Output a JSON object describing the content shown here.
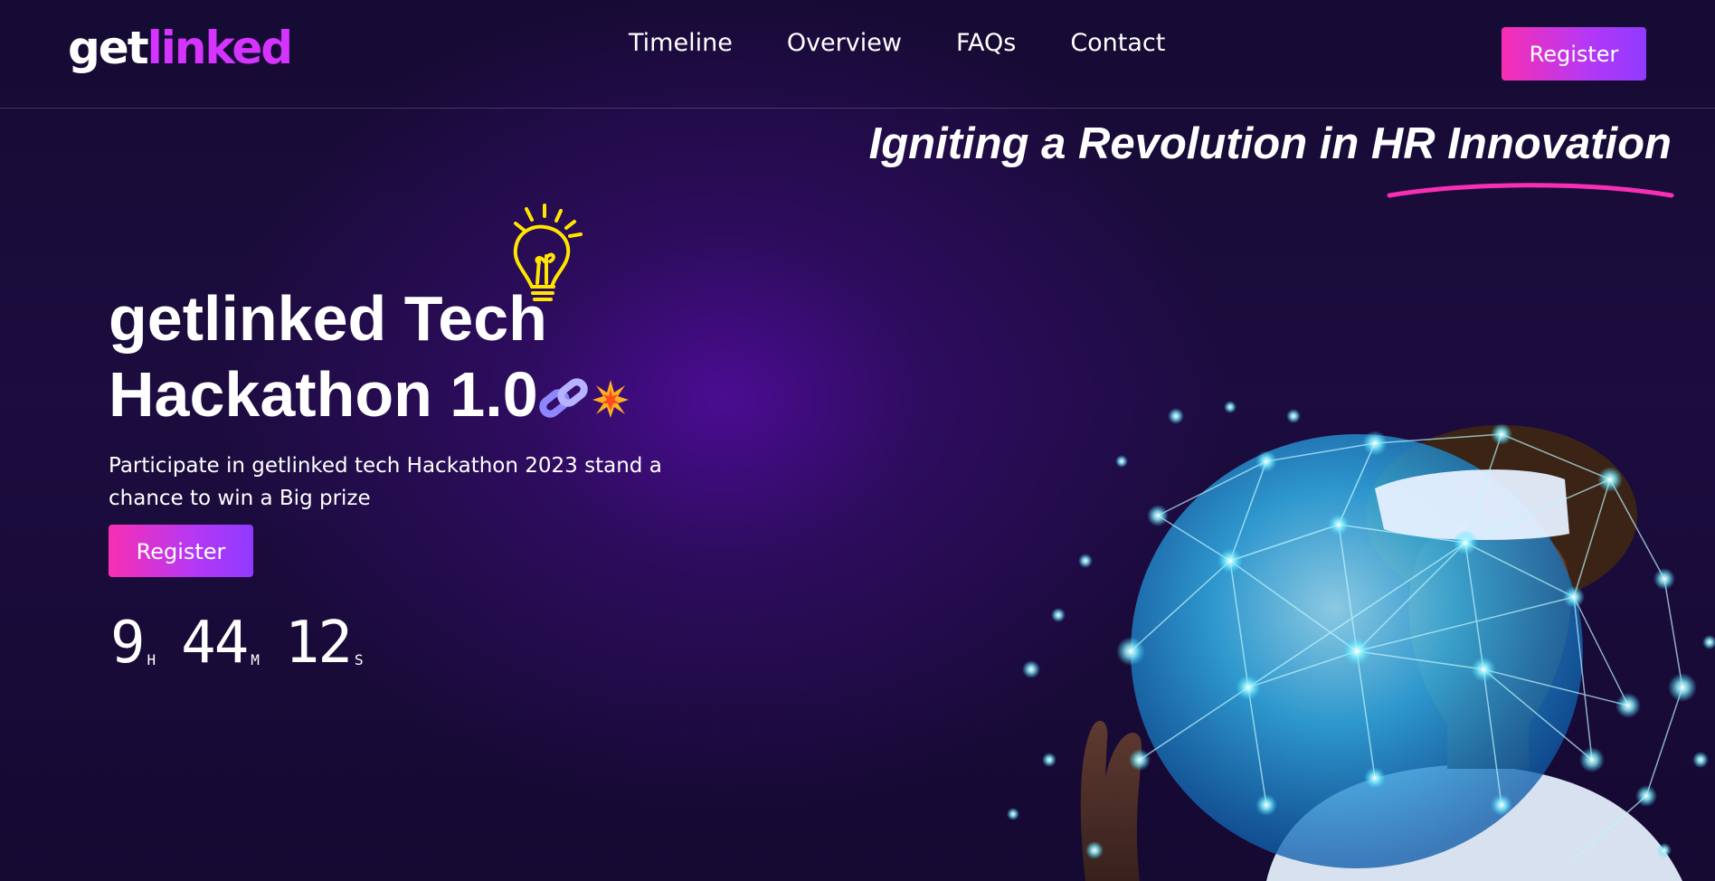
{
  "header": {
    "logo": {
      "part1": "get",
      "part2": "linked"
    },
    "nav": [
      "Timeline",
      "Overview",
      "FAQs",
      "Contact"
    ],
    "register_label": "Register"
  },
  "hero": {
    "tagline": "Igniting a Revolution in HR Innovation",
    "title_line1": "getlinked Tech",
    "title_line2": "Hackathon 1.0",
    "description": "Participate in getlinked tech Hackathon 2023 stand a chance to win a Big prize",
    "register_label": "Register",
    "countdown": {
      "hours": "9",
      "hours_unit": "H",
      "minutes": "44",
      "minutes_unit": "M",
      "seconds": "12",
      "seconds_unit": "S"
    },
    "icons": [
      "lightbulb-icon",
      "chain-link-icon",
      "spark-icon"
    ]
  },
  "colors": {
    "accent_pink": "#f82fb4",
    "accent_purple": "#903aff",
    "logo_purple": "#d434fe",
    "bulb_yellow": "#ffe500",
    "background": "#150a32"
  }
}
